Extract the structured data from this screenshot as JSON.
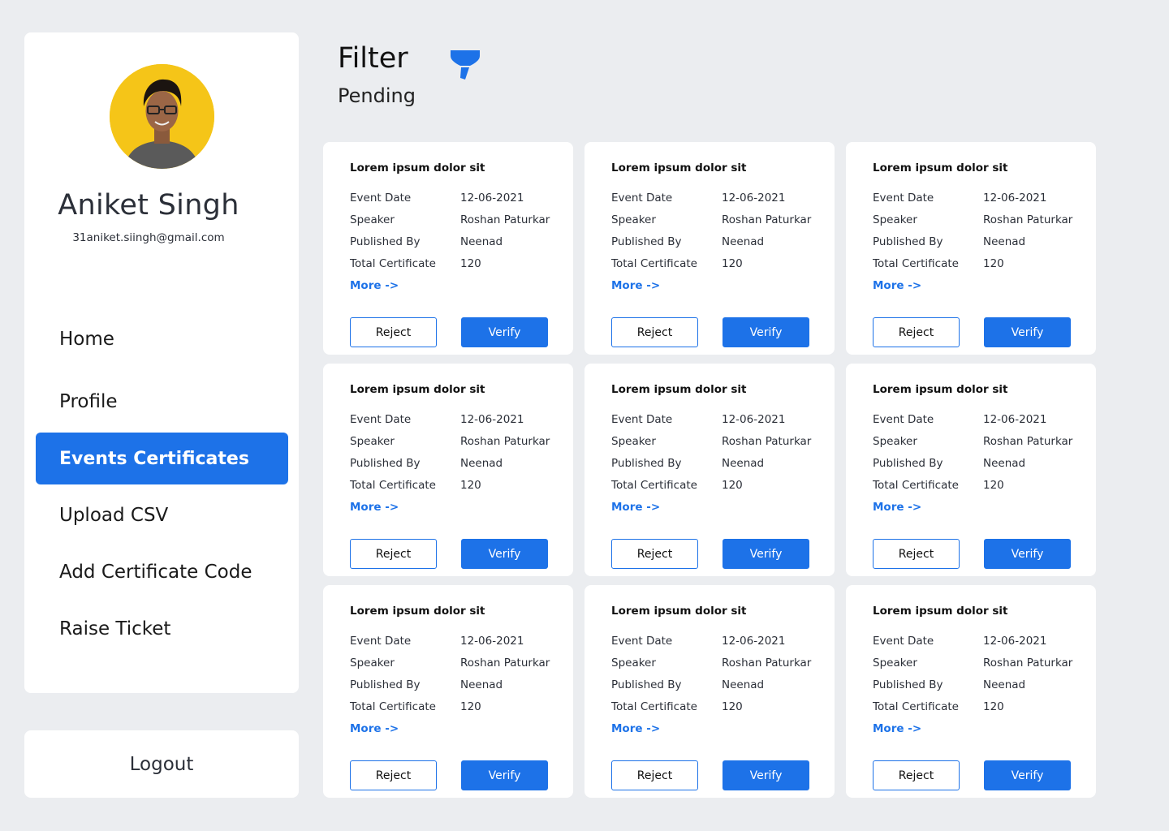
{
  "profile": {
    "name": "Aniket Singh",
    "email": "31aniket.siingh@gmail.com"
  },
  "nav": {
    "items": [
      {
        "label": "Home",
        "active": false
      },
      {
        "label": "Profile",
        "active": false
      },
      {
        "label": "Events Certificates",
        "active": true
      },
      {
        "label": "Upload CSV",
        "active": false
      },
      {
        "label": "Add Certificate Code",
        "active": false
      },
      {
        "label": "Raise Ticket",
        "active": false
      }
    ],
    "logout_label": "Logout"
  },
  "header": {
    "title": "Filter",
    "subtitle": "Pending",
    "filter_icon": "funnel-icon"
  },
  "colors": {
    "accent": "#1d72e8",
    "avatar_bg": "#f5c518",
    "page_bg": "#ebedf0"
  },
  "cards": [
    {
      "title": "Lorem ipsum dolor sit",
      "fields": [
        {
          "label": "Event Date",
          "value": "12-06-2021"
        },
        {
          "label": "Speaker",
          "value": "Roshan Paturkar"
        },
        {
          "label": "Published By",
          "value": "Neenad"
        },
        {
          "label": "Total Certificate",
          "value": "120"
        }
      ],
      "more": "More ->",
      "reject": "Reject",
      "verify": "Verify"
    },
    {
      "title": "Lorem ipsum dolor sit",
      "fields": [
        {
          "label": "Event Date",
          "value": "12-06-2021"
        },
        {
          "label": "Speaker",
          "value": "Roshan Paturkar"
        },
        {
          "label": "Published By",
          "value": "Neenad"
        },
        {
          "label": "Total Certificate",
          "value": "120"
        }
      ],
      "more": "More ->",
      "reject": "Reject",
      "verify": "Verify"
    },
    {
      "title": "Lorem ipsum dolor sit",
      "fields": [
        {
          "label": "Event Date",
          "value": "12-06-2021"
        },
        {
          "label": "Speaker",
          "value": "Roshan Paturkar"
        },
        {
          "label": "Published By",
          "value": "Neenad"
        },
        {
          "label": "Total Certificate",
          "value": "120"
        }
      ],
      "more": "More ->",
      "reject": "Reject",
      "verify": "Verify"
    },
    {
      "title": "Lorem ipsum dolor sit",
      "fields": [
        {
          "label": "Event Date",
          "value": "12-06-2021"
        },
        {
          "label": "Speaker",
          "value": "Roshan Paturkar"
        },
        {
          "label": "Published By",
          "value": "Neenad"
        },
        {
          "label": "Total Certificate",
          "value": "120"
        }
      ],
      "more": "More ->",
      "reject": "Reject",
      "verify": "Verify"
    },
    {
      "title": "Lorem ipsum dolor sit",
      "fields": [
        {
          "label": "Event Date",
          "value": "12-06-2021"
        },
        {
          "label": "Speaker",
          "value": "Roshan Paturkar"
        },
        {
          "label": "Published By",
          "value": "Neenad"
        },
        {
          "label": "Total Certificate",
          "value": "120"
        }
      ],
      "more": "More ->",
      "reject": "Reject",
      "verify": "Verify"
    },
    {
      "title": "Lorem ipsum dolor sit",
      "fields": [
        {
          "label": "Event Date",
          "value": "12-06-2021"
        },
        {
          "label": "Speaker",
          "value": "Roshan Paturkar"
        },
        {
          "label": "Published By",
          "value": "Neenad"
        },
        {
          "label": "Total Certificate",
          "value": "120"
        }
      ],
      "more": "More ->",
      "reject": "Reject",
      "verify": "Verify"
    },
    {
      "title": "Lorem ipsum dolor sit",
      "fields": [
        {
          "label": "Event Date",
          "value": "12-06-2021"
        },
        {
          "label": "Speaker",
          "value": "Roshan Paturkar"
        },
        {
          "label": "Published By",
          "value": "Neenad"
        },
        {
          "label": "Total Certificate",
          "value": "120"
        }
      ],
      "more": "More ->",
      "reject": "Reject",
      "verify": "Verify"
    },
    {
      "title": "Lorem ipsum dolor sit",
      "fields": [
        {
          "label": "Event Date",
          "value": "12-06-2021"
        },
        {
          "label": "Speaker",
          "value": "Roshan Paturkar"
        },
        {
          "label": "Published By",
          "value": "Neenad"
        },
        {
          "label": "Total Certificate",
          "value": "120"
        }
      ],
      "more": "More ->",
      "reject": "Reject",
      "verify": "Verify"
    },
    {
      "title": "Lorem ipsum dolor sit",
      "fields": [
        {
          "label": "Event Date",
          "value": "12-06-2021"
        },
        {
          "label": "Speaker",
          "value": "Roshan Paturkar"
        },
        {
          "label": "Published By",
          "value": "Neenad"
        },
        {
          "label": "Total Certificate",
          "value": "120"
        }
      ],
      "more": "More ->",
      "reject": "Reject",
      "verify": "Verify"
    }
  ]
}
